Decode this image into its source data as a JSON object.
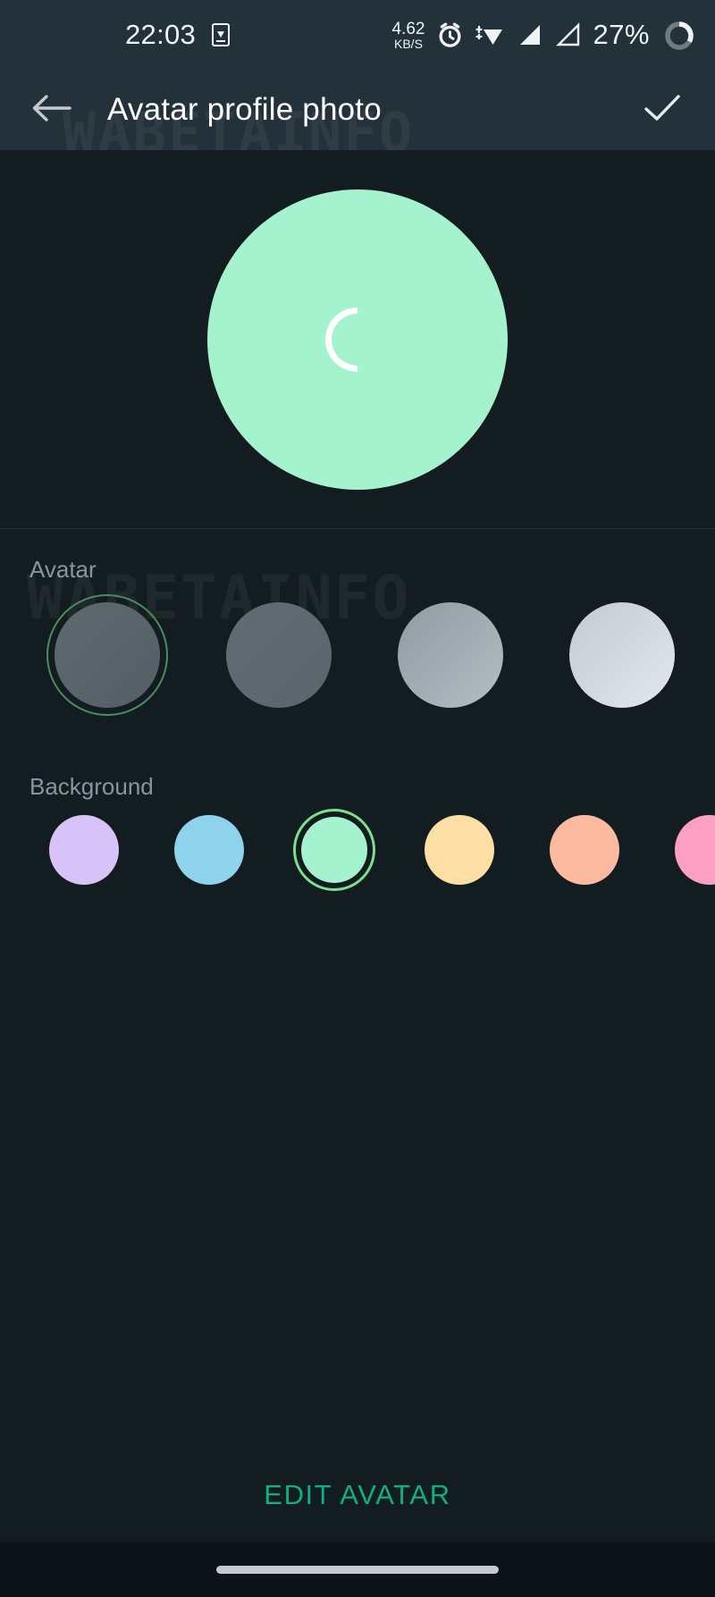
{
  "status_bar": {
    "time": "22:03",
    "cast_icon": "screen-cast-icon",
    "network_speed_value": "4.62",
    "network_speed_unit": "KB/S",
    "alarm_icon": "alarm-clock-icon",
    "wifi_icon": "wifi-icon",
    "signal_icon_1": "cellular-signal-icon",
    "signal_icon_2": "cellular-signal-icon",
    "battery_percent": "27%",
    "battery_icon": "battery-ring-icon"
  },
  "toolbar": {
    "back_icon": "back-arrow-icon",
    "title": "Avatar profile photo",
    "confirm_icon": "checkmark-icon"
  },
  "watermark": {
    "text": "WABETAINFO"
  },
  "preview": {
    "background_color": "#A5F3CE",
    "loading_icon": "loading-spinner-icon"
  },
  "avatar_section": {
    "label": "Avatar",
    "selection_ring_color": "#4A8C5C",
    "selected_index": 0,
    "swatches": [
      {
        "name": "avatar-skin-tone-1",
        "color_start": "#5F6A70",
        "color_end": "#545E64",
        "selected": true
      },
      {
        "name": "avatar-skin-tone-2",
        "color_start": "#616C74",
        "color_end": "#5A646B",
        "selected": false
      },
      {
        "name": "avatar-skin-tone-3",
        "color_start": "#8E9BA1",
        "color_end": "#B3BEC3",
        "selected": false
      },
      {
        "name": "avatar-skin-tone-4",
        "color_start": "#C3CBD0",
        "color_end": "#E2E8EB",
        "selected": false
      },
      {
        "name": "avatar-skin-tone-5",
        "color_start": "#A8B3B9",
        "color_end": "#8E999F",
        "selected": false
      }
    ]
  },
  "background_section": {
    "label": "Background",
    "selection_ring_color": "#7BE08C",
    "selected_index": 2,
    "swatches": [
      {
        "name": "background-color-lavender",
        "color": "#D8C3F8",
        "selected": false
      },
      {
        "name": "background-color-sky-blue",
        "color": "#8ED2EC",
        "selected": false
      },
      {
        "name": "background-color-mint-green",
        "color": "#A5F3CE",
        "selected": true
      },
      {
        "name": "background-color-cream-yellow",
        "color": "#FBDFA5",
        "selected": false
      },
      {
        "name": "background-color-salmon",
        "color": "#FCBBA0",
        "selected": false
      },
      {
        "name": "background-color-pink",
        "color": "#FC9FC3",
        "selected": false
      },
      {
        "name": "background-color-light-gray",
        "color": "#CFD8DC",
        "selected": false
      }
    ]
  },
  "footer": {
    "edit_avatar_label": "EDIT AVATAR",
    "edit_avatar_color": "#10AE85"
  },
  "nav_bar": {
    "gesture_pill": "home-gesture-pill"
  }
}
